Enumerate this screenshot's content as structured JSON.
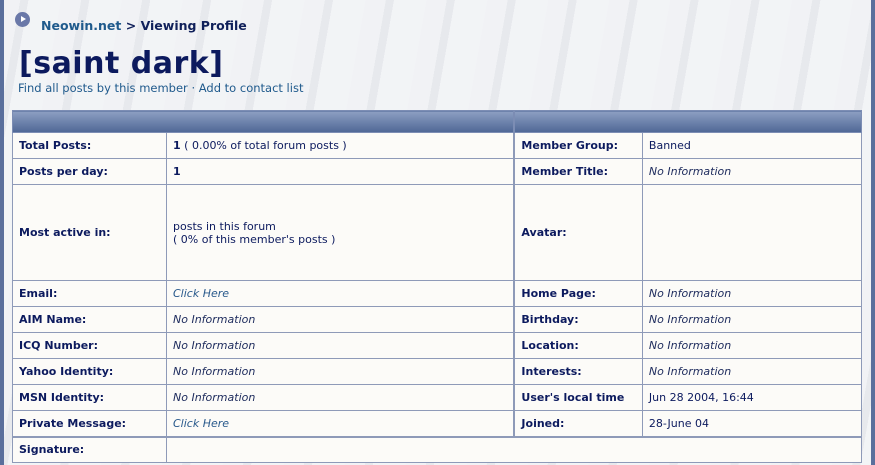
{
  "breadcrumb": {
    "site": "Neowin.net",
    "separator": ">",
    "current": "Viewing Profile"
  },
  "title": "[saint dark]",
  "links": {
    "find_posts": "Find all posts by this member",
    "dot": "·",
    "add_contact": "Add to contact list"
  },
  "left": {
    "total_posts_label": "Total Posts:",
    "total_posts_count": "1",
    "total_posts_pct": "( 0.00% of total forum posts )",
    "posts_per_day_label": "Posts per day:",
    "posts_per_day": "1",
    "most_active_label": "Most active in:",
    "most_active_line1": "posts in this forum",
    "most_active_line2": "( 0% of this member's posts )",
    "email_label": "Email:",
    "email": "Click Here",
    "aim_label": "AIM Name:",
    "aim": "No Information",
    "icq_label": "ICQ Number:",
    "icq": "No Information",
    "yahoo_label": "Yahoo Identity:",
    "yahoo": "No Information",
    "msn_label": "MSN Identity:",
    "msn": "No Information",
    "pm_label": "Private Message:",
    "pm": "Click Here",
    "signature_label": "Signature:"
  },
  "right": {
    "group_label": "Member Group:",
    "group": "Banned",
    "title_label": "Member Title:",
    "title": "No Information",
    "avatar_label": "Avatar:",
    "homepage_label": "Home Page:",
    "homepage": "No Information",
    "birthday_label": "Birthday:",
    "birthday": "No Information",
    "location_label": "Location:",
    "location": "No Information",
    "interests_label": "Interests:",
    "interests": "No Information",
    "localtime_label": "User's local time",
    "localtime": "Jun 28 2004, 16:44",
    "joined_label": "Joined:",
    "joined": "28-June 04"
  }
}
